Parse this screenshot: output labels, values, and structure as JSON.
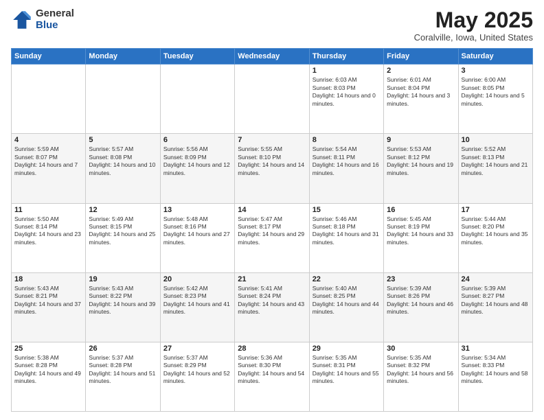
{
  "logo": {
    "general": "General",
    "blue": "Blue"
  },
  "title": {
    "month": "May 2025",
    "location": "Coralville, Iowa, United States"
  },
  "weekdays": [
    "Sunday",
    "Monday",
    "Tuesday",
    "Wednesday",
    "Thursday",
    "Friday",
    "Saturday"
  ],
  "weeks": [
    [
      {
        "day": "",
        "sunrise": "",
        "sunset": "",
        "daylight": ""
      },
      {
        "day": "",
        "sunrise": "",
        "sunset": "",
        "daylight": ""
      },
      {
        "day": "",
        "sunrise": "",
        "sunset": "",
        "daylight": ""
      },
      {
        "day": "",
        "sunrise": "",
        "sunset": "",
        "daylight": ""
      },
      {
        "day": "1",
        "sunrise": "Sunrise: 6:03 AM",
        "sunset": "Sunset: 8:03 PM",
        "daylight": "Daylight: 14 hours and 0 minutes."
      },
      {
        "day": "2",
        "sunrise": "Sunrise: 6:01 AM",
        "sunset": "Sunset: 8:04 PM",
        "daylight": "Daylight: 14 hours and 3 minutes."
      },
      {
        "day": "3",
        "sunrise": "Sunrise: 6:00 AM",
        "sunset": "Sunset: 8:05 PM",
        "daylight": "Daylight: 14 hours and 5 minutes."
      }
    ],
    [
      {
        "day": "4",
        "sunrise": "Sunrise: 5:59 AM",
        "sunset": "Sunset: 8:07 PM",
        "daylight": "Daylight: 14 hours and 7 minutes."
      },
      {
        "day": "5",
        "sunrise": "Sunrise: 5:57 AM",
        "sunset": "Sunset: 8:08 PM",
        "daylight": "Daylight: 14 hours and 10 minutes."
      },
      {
        "day": "6",
        "sunrise": "Sunrise: 5:56 AM",
        "sunset": "Sunset: 8:09 PM",
        "daylight": "Daylight: 14 hours and 12 minutes."
      },
      {
        "day": "7",
        "sunrise": "Sunrise: 5:55 AM",
        "sunset": "Sunset: 8:10 PM",
        "daylight": "Daylight: 14 hours and 14 minutes."
      },
      {
        "day": "8",
        "sunrise": "Sunrise: 5:54 AM",
        "sunset": "Sunset: 8:11 PM",
        "daylight": "Daylight: 14 hours and 16 minutes."
      },
      {
        "day": "9",
        "sunrise": "Sunrise: 5:53 AM",
        "sunset": "Sunset: 8:12 PM",
        "daylight": "Daylight: 14 hours and 19 minutes."
      },
      {
        "day": "10",
        "sunrise": "Sunrise: 5:52 AM",
        "sunset": "Sunset: 8:13 PM",
        "daylight": "Daylight: 14 hours and 21 minutes."
      }
    ],
    [
      {
        "day": "11",
        "sunrise": "Sunrise: 5:50 AM",
        "sunset": "Sunset: 8:14 PM",
        "daylight": "Daylight: 14 hours and 23 minutes."
      },
      {
        "day": "12",
        "sunrise": "Sunrise: 5:49 AM",
        "sunset": "Sunset: 8:15 PM",
        "daylight": "Daylight: 14 hours and 25 minutes."
      },
      {
        "day": "13",
        "sunrise": "Sunrise: 5:48 AM",
        "sunset": "Sunset: 8:16 PM",
        "daylight": "Daylight: 14 hours and 27 minutes."
      },
      {
        "day": "14",
        "sunrise": "Sunrise: 5:47 AM",
        "sunset": "Sunset: 8:17 PM",
        "daylight": "Daylight: 14 hours and 29 minutes."
      },
      {
        "day": "15",
        "sunrise": "Sunrise: 5:46 AM",
        "sunset": "Sunset: 8:18 PM",
        "daylight": "Daylight: 14 hours and 31 minutes."
      },
      {
        "day": "16",
        "sunrise": "Sunrise: 5:45 AM",
        "sunset": "Sunset: 8:19 PM",
        "daylight": "Daylight: 14 hours and 33 minutes."
      },
      {
        "day": "17",
        "sunrise": "Sunrise: 5:44 AM",
        "sunset": "Sunset: 8:20 PM",
        "daylight": "Daylight: 14 hours and 35 minutes."
      }
    ],
    [
      {
        "day": "18",
        "sunrise": "Sunrise: 5:43 AM",
        "sunset": "Sunset: 8:21 PM",
        "daylight": "Daylight: 14 hours and 37 minutes."
      },
      {
        "day": "19",
        "sunrise": "Sunrise: 5:43 AM",
        "sunset": "Sunset: 8:22 PM",
        "daylight": "Daylight: 14 hours and 39 minutes."
      },
      {
        "day": "20",
        "sunrise": "Sunrise: 5:42 AM",
        "sunset": "Sunset: 8:23 PM",
        "daylight": "Daylight: 14 hours and 41 minutes."
      },
      {
        "day": "21",
        "sunrise": "Sunrise: 5:41 AM",
        "sunset": "Sunset: 8:24 PM",
        "daylight": "Daylight: 14 hours and 43 minutes."
      },
      {
        "day": "22",
        "sunrise": "Sunrise: 5:40 AM",
        "sunset": "Sunset: 8:25 PM",
        "daylight": "Daylight: 14 hours and 44 minutes."
      },
      {
        "day": "23",
        "sunrise": "Sunrise: 5:39 AM",
        "sunset": "Sunset: 8:26 PM",
        "daylight": "Daylight: 14 hours and 46 minutes."
      },
      {
        "day": "24",
        "sunrise": "Sunrise: 5:39 AM",
        "sunset": "Sunset: 8:27 PM",
        "daylight": "Daylight: 14 hours and 48 minutes."
      }
    ],
    [
      {
        "day": "25",
        "sunrise": "Sunrise: 5:38 AM",
        "sunset": "Sunset: 8:28 PM",
        "daylight": "Daylight: 14 hours and 49 minutes."
      },
      {
        "day": "26",
        "sunrise": "Sunrise: 5:37 AM",
        "sunset": "Sunset: 8:28 PM",
        "daylight": "Daylight: 14 hours and 51 minutes."
      },
      {
        "day": "27",
        "sunrise": "Sunrise: 5:37 AM",
        "sunset": "Sunset: 8:29 PM",
        "daylight": "Daylight: 14 hours and 52 minutes."
      },
      {
        "day": "28",
        "sunrise": "Sunrise: 5:36 AM",
        "sunset": "Sunset: 8:30 PM",
        "daylight": "Daylight: 14 hours and 54 minutes."
      },
      {
        "day": "29",
        "sunrise": "Sunrise: 5:35 AM",
        "sunset": "Sunset: 8:31 PM",
        "daylight": "Daylight: 14 hours and 55 minutes."
      },
      {
        "day": "30",
        "sunrise": "Sunrise: 5:35 AM",
        "sunset": "Sunset: 8:32 PM",
        "daylight": "Daylight: 14 hours and 56 minutes."
      },
      {
        "day": "31",
        "sunrise": "Sunrise: 5:34 AM",
        "sunset": "Sunset: 8:33 PM",
        "daylight": "Daylight: 14 hours and 58 minutes."
      }
    ]
  ]
}
